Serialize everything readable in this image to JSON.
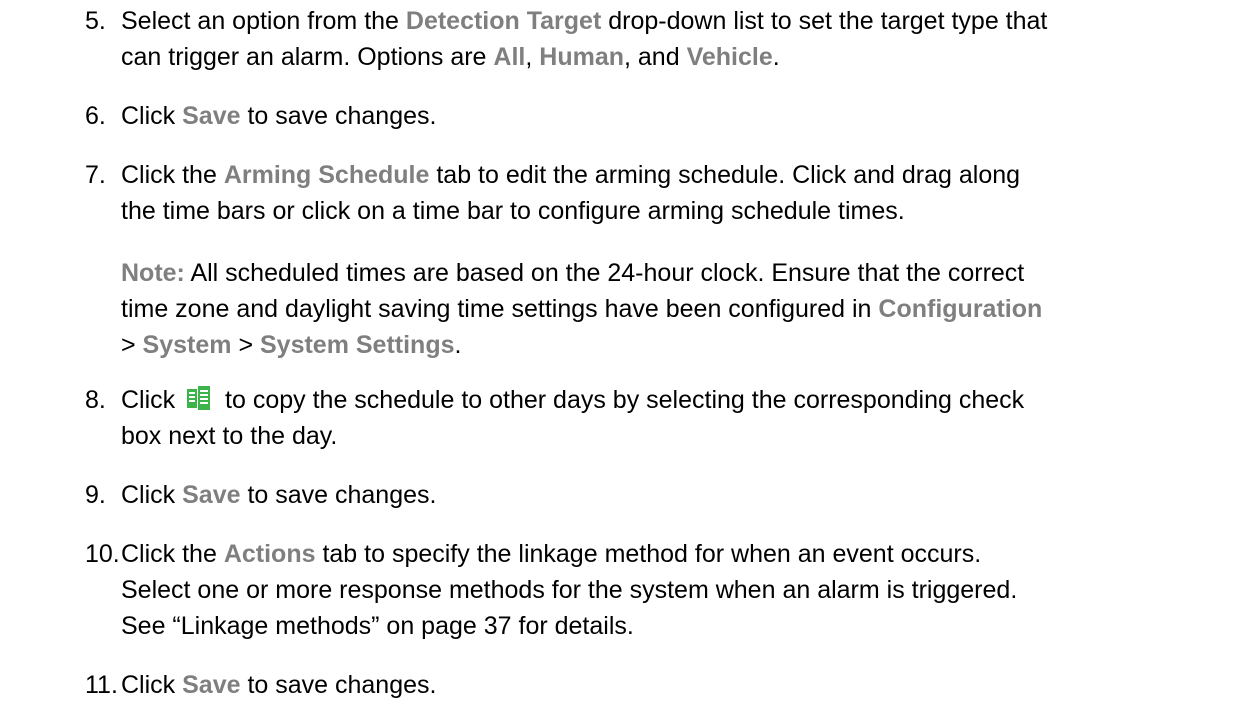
{
  "step5": {
    "num": "5.",
    "l1_a": "Select an option from the ",
    "l1_b": "Detection Target",
    "l1_c": " drop-down list to set the target type that",
    "l2_a": "can trigger an alarm. Options are ",
    "l2_b": "All",
    "l2_c": ", ",
    "l2_d": "Human",
    "l2_e": ", and ",
    "l2_f": "Vehicle",
    "l2_g": "."
  },
  "step6": {
    "num": "6.",
    "a": "Click ",
    "b": "Save",
    "c": " to save changes."
  },
  "step7": {
    "num": "7.",
    "l1_a": "Click the ",
    "l1_b": "Arming Schedule",
    "l1_c": " tab to edit the arming schedule. Click and drag along",
    "l2": "the time bars or click on a time bar to configure arming schedule times."
  },
  "note": {
    "label": "Note:",
    "l1": " All scheduled times are based on the 24-hour clock. Ensure that the correct",
    "l2_a": "time zone and daylight saving time settings have been configured in ",
    "l2_b": "Configuration",
    "l3_a": "> ",
    "l3_b": "System",
    "l3_c": " > ",
    "l3_d": "System Settings",
    "l3_e": "."
  },
  "step8": {
    "num": "8.",
    "l1_a": "Click ",
    "icon": "copy-schedule-icon",
    "l1_b": " to copy the schedule to other days by selecting the corresponding check",
    "l2": "box next to the day."
  },
  "step9": {
    "num": "9.",
    "a": "Click ",
    "b": "Save",
    "c": " to save changes."
  },
  "step10": {
    "num": "10.",
    "l1_a": "Click the ",
    "l1_b": "Actions",
    "l1_c": " tab to specify the linkage method for when an event occurs.",
    "l2": "Select one or more response methods for the system when an alarm is triggered.",
    "l3": "See “Linkage methods” on page 37 for details."
  },
  "step11": {
    "num": "11.",
    "a": "Click ",
    "b": "Save",
    "c": " to save changes."
  },
  "colors": {
    "text": "#000000",
    "emphasis": "#7f7f7f",
    "icon_green": "#3cb44a"
  }
}
